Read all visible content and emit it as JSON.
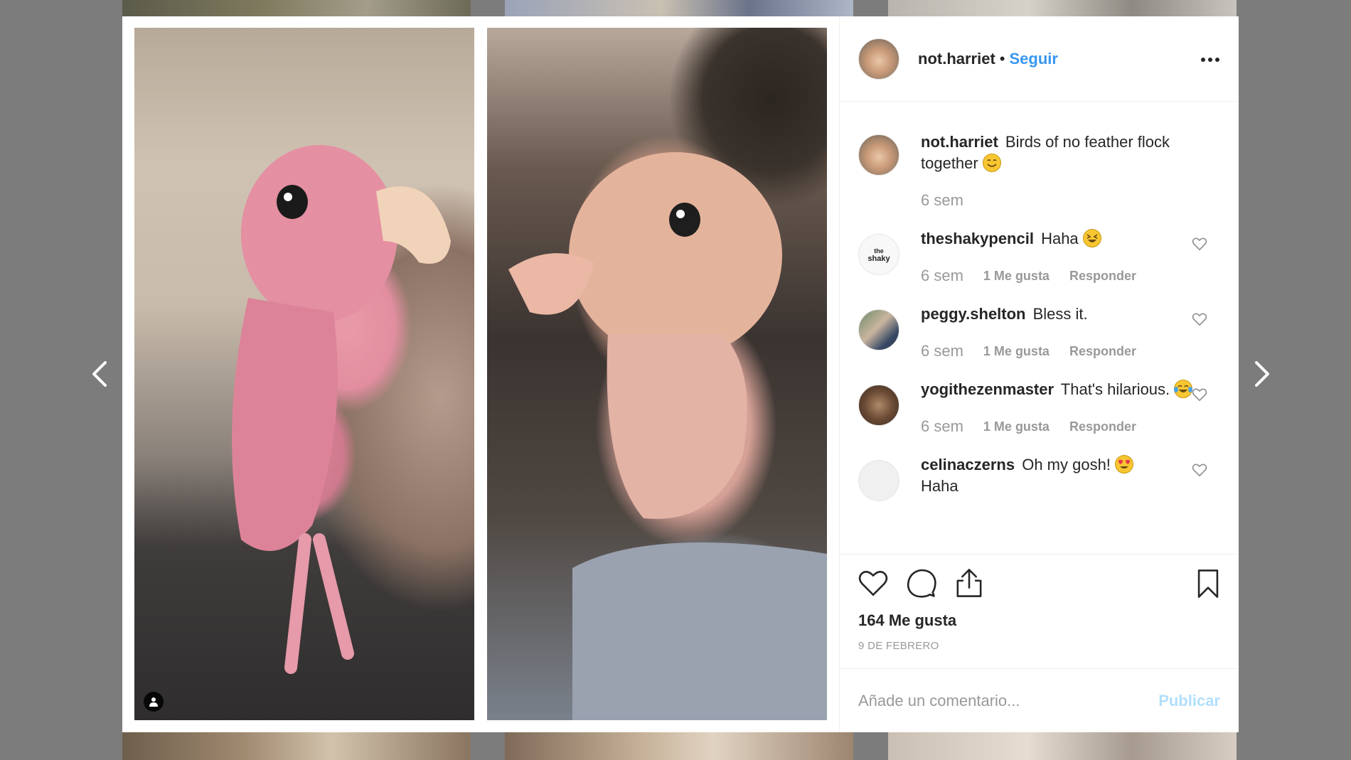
{
  "post": {
    "username": "not.harriet",
    "separator": "•",
    "follow_label": "Seguir",
    "likes": "164 Me gusta",
    "date": "9 DE FEBRERO"
  },
  "caption": {
    "username": "not.harriet",
    "text": "Birds of no feather flock together",
    "time": "6 sem"
  },
  "comments": [
    {
      "username": "theshakypencil",
      "text": "Haha",
      "time": "6 sem",
      "likes": "1 Me gusta",
      "reply": "Responder",
      "emoji": "laughing-squint-emoji"
    },
    {
      "username": "peggy.shelton",
      "text": "Bless it.",
      "time": "6 sem",
      "likes": "1 Me gusta",
      "reply": "Responder"
    },
    {
      "username": "yogithezenmaster",
      "text": "That's hilarious.",
      "time": "6 sem",
      "likes": "1 Me gusta",
      "reply": "Responder",
      "emoji": "tears-of-joy-emoji"
    },
    {
      "username": "celinaczerns",
      "text": "Oh my gosh!",
      "text2": "Haha"
    }
  ],
  "composer": {
    "placeholder": "Añade un comentario...",
    "publish_label": "Publicar"
  },
  "colors": {
    "link_blue": "#3897f0",
    "publish_disabled": "#b2dffc",
    "muted": "#999999",
    "backdrop": "#7c7c7c"
  }
}
